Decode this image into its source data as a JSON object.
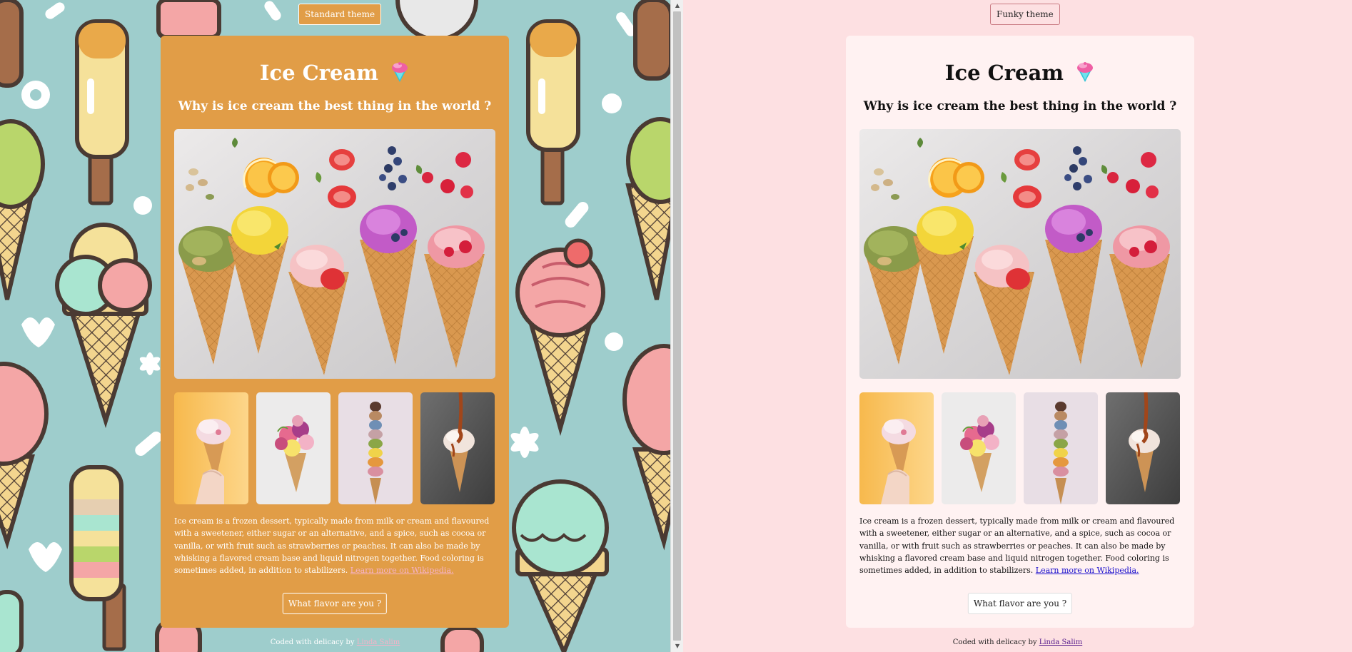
{
  "funky": {
    "theme_button": "Standard theme",
    "title": "Ice Cream",
    "subtitle": "Why is ice cream the best thing in the world ?",
    "description": "Ice cream is a frozen dessert, typically made from milk or cream and flavoured with a sweetener, either sugar or an alternative, and a spice, such as cocoa or vanilla, or with fruit such as strawberries or peaches. It can also be made by whisking a flavored cream base and liquid nitrogen together. Food coloring is sometimes added, in addition to stabilizers.",
    "link_text": "Learn more on Wikipedia.",
    "flavor_button": "What flavor are you ?",
    "footer_prefix": "Coded with delicacy by",
    "footer_author": "Linda Salim"
  },
  "standard": {
    "theme_button": "Funky theme",
    "title": "Ice Cream",
    "subtitle": "Why is ice cream the best thing in the world ?",
    "description": "Ice cream is a frozen dessert, typically made from milk or cream and flavoured with a sweetener, either sugar or an alternative, and a spice, such as cocoa or vanilla, or with fruit such as strawberries or peaches. It can also be made by whisking a flavored cream base and liquid nitrogen together. Food coloring is sometimes added, in addition to stabilizers.",
    "link_text": "Learn more on Wikipedia.",
    "flavor_button": "What flavor are you ?",
    "footer_prefix": "Coded with delicacy by",
    "footer_author": "Linda Salim"
  },
  "scrollbar": {
    "up_arrow": "▲",
    "down_arrow": "▼"
  },
  "colors": {
    "funky_background": "#9ecdcc",
    "funky_card": "#e19d47",
    "standard_background": "#fde0e2",
    "standard_card": "#fff2f2",
    "funky_link": "#f6b2c7",
    "standard_link": "#1a0dcc"
  },
  "icons": [
    "shaved-ice-emoji-icon",
    "ice-cream-cones-hero-photo",
    "hand-held-cone-photo",
    "flower-bouquet-cone-photo",
    "stacked-scoops-cone-photo",
    "drizzle-cone-photo"
  ]
}
